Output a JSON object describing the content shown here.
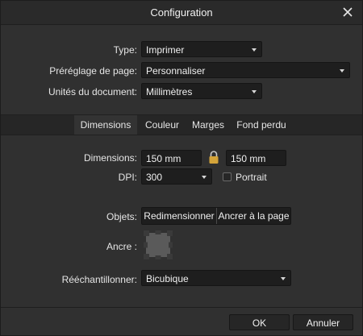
{
  "window": {
    "title": "Configuration"
  },
  "type": {
    "label": "Type:",
    "value": "Imprimer"
  },
  "preset": {
    "label": "Préréglage de page:",
    "value": "Personnaliser"
  },
  "units": {
    "label": "Unités du document:",
    "value": "Millimètres"
  },
  "tabs": [
    "Dimensions",
    "Couleur",
    "Marges",
    "Fond perdu"
  ],
  "dimensions": {
    "label": "Dimensions:",
    "width": "150 mm",
    "height": "150 mm"
  },
  "dpi": {
    "label": "DPI:",
    "value": "300"
  },
  "portrait": {
    "label": "Portrait",
    "checked": false
  },
  "objects": {
    "label": "Objets:",
    "options": [
      "Redimensionner",
      "Ancrer à la page"
    ]
  },
  "anchor": {
    "label": "Ancre :"
  },
  "resample": {
    "label": "Rééchantillonner:",
    "value": "Bicubique"
  },
  "buttons": {
    "ok": "OK",
    "cancel": "Annuler"
  },
  "colors": {
    "accent": "#d4a43a",
    "background": "#303030"
  }
}
